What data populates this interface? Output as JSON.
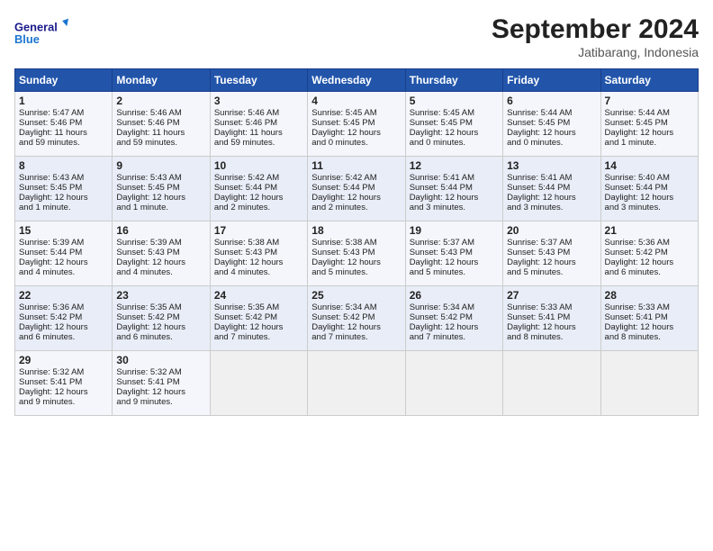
{
  "header": {
    "logo_line1": "General",
    "logo_line2": "Blue",
    "month": "September 2024",
    "location": "Jatibarang, Indonesia"
  },
  "days_of_week": [
    "Sunday",
    "Monday",
    "Tuesday",
    "Wednesday",
    "Thursday",
    "Friday",
    "Saturday"
  ],
  "weeks": [
    [
      {
        "day": "1",
        "lines": [
          "Sunrise: 5:47 AM",
          "Sunset: 5:46 PM",
          "Daylight: 11 hours",
          "and 59 minutes."
        ]
      },
      {
        "day": "2",
        "lines": [
          "Sunrise: 5:46 AM",
          "Sunset: 5:46 PM",
          "Daylight: 11 hours",
          "and 59 minutes."
        ]
      },
      {
        "day": "3",
        "lines": [
          "Sunrise: 5:46 AM",
          "Sunset: 5:46 PM",
          "Daylight: 11 hours",
          "and 59 minutes."
        ]
      },
      {
        "day": "4",
        "lines": [
          "Sunrise: 5:45 AM",
          "Sunset: 5:45 PM",
          "Daylight: 12 hours",
          "and 0 minutes."
        ]
      },
      {
        "day": "5",
        "lines": [
          "Sunrise: 5:45 AM",
          "Sunset: 5:45 PM",
          "Daylight: 12 hours",
          "and 0 minutes."
        ]
      },
      {
        "day": "6",
        "lines": [
          "Sunrise: 5:44 AM",
          "Sunset: 5:45 PM",
          "Daylight: 12 hours",
          "and 0 minutes."
        ]
      },
      {
        "day": "7",
        "lines": [
          "Sunrise: 5:44 AM",
          "Sunset: 5:45 PM",
          "Daylight: 12 hours",
          "and 1 minute."
        ]
      }
    ],
    [
      {
        "day": "8",
        "lines": [
          "Sunrise: 5:43 AM",
          "Sunset: 5:45 PM",
          "Daylight: 12 hours",
          "and 1 minute."
        ]
      },
      {
        "day": "9",
        "lines": [
          "Sunrise: 5:43 AM",
          "Sunset: 5:45 PM",
          "Daylight: 12 hours",
          "and 1 minute."
        ]
      },
      {
        "day": "10",
        "lines": [
          "Sunrise: 5:42 AM",
          "Sunset: 5:44 PM",
          "Daylight: 12 hours",
          "and 2 minutes."
        ]
      },
      {
        "day": "11",
        "lines": [
          "Sunrise: 5:42 AM",
          "Sunset: 5:44 PM",
          "Daylight: 12 hours",
          "and 2 minutes."
        ]
      },
      {
        "day": "12",
        "lines": [
          "Sunrise: 5:41 AM",
          "Sunset: 5:44 PM",
          "Daylight: 12 hours",
          "and 3 minutes."
        ]
      },
      {
        "day": "13",
        "lines": [
          "Sunrise: 5:41 AM",
          "Sunset: 5:44 PM",
          "Daylight: 12 hours",
          "and 3 minutes."
        ]
      },
      {
        "day": "14",
        "lines": [
          "Sunrise: 5:40 AM",
          "Sunset: 5:44 PM",
          "Daylight: 12 hours",
          "and 3 minutes."
        ]
      }
    ],
    [
      {
        "day": "15",
        "lines": [
          "Sunrise: 5:39 AM",
          "Sunset: 5:44 PM",
          "Daylight: 12 hours",
          "and 4 minutes."
        ]
      },
      {
        "day": "16",
        "lines": [
          "Sunrise: 5:39 AM",
          "Sunset: 5:43 PM",
          "Daylight: 12 hours",
          "and 4 minutes."
        ]
      },
      {
        "day": "17",
        "lines": [
          "Sunrise: 5:38 AM",
          "Sunset: 5:43 PM",
          "Daylight: 12 hours",
          "and 4 minutes."
        ]
      },
      {
        "day": "18",
        "lines": [
          "Sunrise: 5:38 AM",
          "Sunset: 5:43 PM",
          "Daylight: 12 hours",
          "and 5 minutes."
        ]
      },
      {
        "day": "19",
        "lines": [
          "Sunrise: 5:37 AM",
          "Sunset: 5:43 PM",
          "Daylight: 12 hours",
          "and 5 minutes."
        ]
      },
      {
        "day": "20",
        "lines": [
          "Sunrise: 5:37 AM",
          "Sunset: 5:43 PM",
          "Daylight: 12 hours",
          "and 5 minutes."
        ]
      },
      {
        "day": "21",
        "lines": [
          "Sunrise: 5:36 AM",
          "Sunset: 5:42 PM",
          "Daylight: 12 hours",
          "and 6 minutes."
        ]
      }
    ],
    [
      {
        "day": "22",
        "lines": [
          "Sunrise: 5:36 AM",
          "Sunset: 5:42 PM",
          "Daylight: 12 hours",
          "and 6 minutes."
        ]
      },
      {
        "day": "23",
        "lines": [
          "Sunrise: 5:35 AM",
          "Sunset: 5:42 PM",
          "Daylight: 12 hours",
          "and 6 minutes."
        ]
      },
      {
        "day": "24",
        "lines": [
          "Sunrise: 5:35 AM",
          "Sunset: 5:42 PM",
          "Daylight: 12 hours",
          "and 7 minutes."
        ]
      },
      {
        "day": "25",
        "lines": [
          "Sunrise: 5:34 AM",
          "Sunset: 5:42 PM",
          "Daylight: 12 hours",
          "and 7 minutes."
        ]
      },
      {
        "day": "26",
        "lines": [
          "Sunrise: 5:34 AM",
          "Sunset: 5:42 PM",
          "Daylight: 12 hours",
          "and 7 minutes."
        ]
      },
      {
        "day": "27",
        "lines": [
          "Sunrise: 5:33 AM",
          "Sunset: 5:41 PM",
          "Daylight: 12 hours",
          "and 8 minutes."
        ]
      },
      {
        "day": "28",
        "lines": [
          "Sunrise: 5:33 AM",
          "Sunset: 5:41 PM",
          "Daylight: 12 hours",
          "and 8 minutes."
        ]
      }
    ],
    [
      {
        "day": "29",
        "lines": [
          "Sunrise: 5:32 AM",
          "Sunset: 5:41 PM",
          "Daylight: 12 hours",
          "and 9 minutes."
        ]
      },
      {
        "day": "30",
        "lines": [
          "Sunrise: 5:32 AM",
          "Sunset: 5:41 PM",
          "Daylight: 12 hours",
          "and 9 minutes."
        ]
      },
      {
        "day": "",
        "lines": []
      },
      {
        "day": "",
        "lines": []
      },
      {
        "day": "",
        "lines": []
      },
      {
        "day": "",
        "lines": []
      },
      {
        "day": "",
        "lines": []
      }
    ]
  ]
}
